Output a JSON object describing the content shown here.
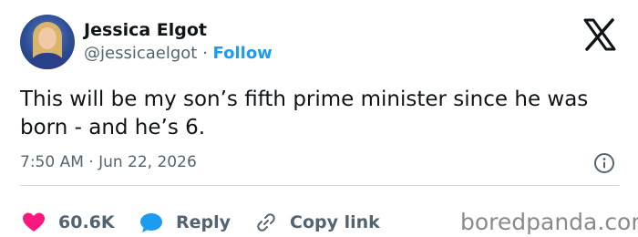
{
  "author": {
    "name": "Jessica Elgot",
    "handle": "@jessicaelgot",
    "separator": "·",
    "follow_label": "Follow"
  },
  "tweet": {
    "text": "This will be my son’s fifth prime minister since he was born - and he’s 6.",
    "timestamp": "7:50 AM · Jun 22, 2026"
  },
  "actions": {
    "like_count": "60.6K",
    "reply_label": "Reply",
    "copy_link_label": "Copy link"
  },
  "watermark": "boredpanda.com",
  "colors": {
    "accent": "#1d9bf0",
    "like": "#f91880",
    "text": "#0f1419",
    "secondary": "#536471"
  },
  "icons": [
    "x-logo-icon",
    "info-icon",
    "heart-icon",
    "reply-bubble-icon",
    "link-icon"
  ]
}
